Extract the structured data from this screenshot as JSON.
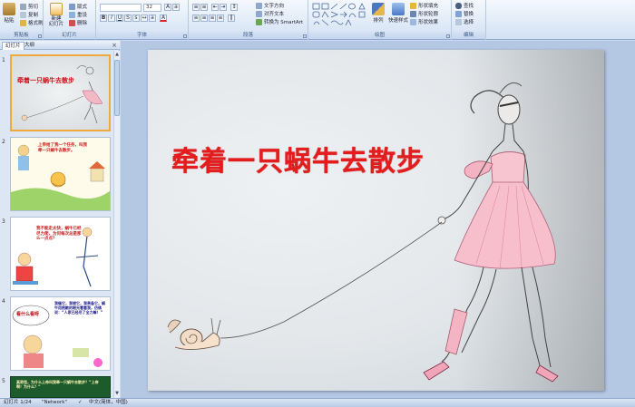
{
  "ribbon": {
    "clipboard": {
      "label": "剪贴板",
      "paste": "粘贴",
      "cut": "剪切",
      "copy": "复制",
      "format_painter": "格式刷"
    },
    "slides": {
      "label": "幻灯片",
      "new_slide": "新建\n幻灯片",
      "layout": "版式",
      "reset": "重设",
      "delete": "删除"
    },
    "font": {
      "label": "字体",
      "size": "32"
    },
    "paragraph": {
      "label": "段落",
      "text_direction": "文字方向",
      "align_text": "对齐文本",
      "smartart": "转换为 SmartArt"
    },
    "drawing": {
      "label": "绘图",
      "arrange": "排列",
      "quick_styles": "快速样式",
      "shape_fill": "形状填充",
      "shape_outline": "形状轮廓",
      "shape_effects": "形状效果"
    },
    "editing": {
      "label": "编辑",
      "find": "查找",
      "replace": "替换",
      "select": "选择"
    }
  },
  "panel": {
    "tabs": [
      "幻灯片",
      "大纲"
    ],
    "close": "×",
    "slides": [
      {
        "number": "1",
        "title": "牵着一只蜗牛去散步"
      },
      {
        "number": "2",
        "text": "上帝给了我一个任务，叫我牵一只蜗牛去散步。"
      },
      {
        "number": "3",
        "text": "我不能走太快，蜗牛已经尽力爬，为何每次总是那么一点点？"
      },
      {
        "number": "4",
        "bubble": "看什么看呀",
        "text": "我催它，我唬它，我责备它，蜗牛用抱歉的眼光看着我，仿佛说：“人家已经尽了全力嘛！”"
      },
      {
        "number": "5",
        "text": "真奇怪，为什么上帝叫我牵一只蜗牛去散步？“上帝啊！为什么？”"
      }
    ]
  },
  "slide": {
    "title": "牵着一只蜗牛去散步"
  },
  "status": {
    "slide_info": "幻灯片 1/24",
    "theme": "\"Network\"",
    "language": "中文(简体，中国)"
  }
}
